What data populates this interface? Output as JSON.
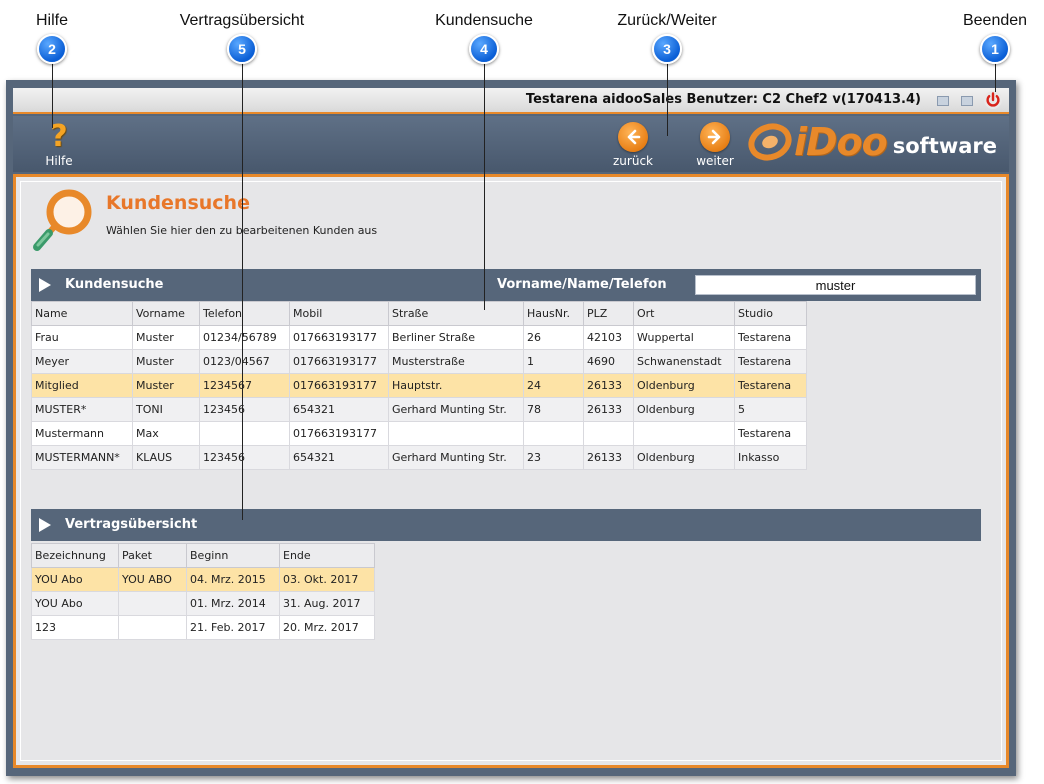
{
  "callouts": [
    {
      "label": "Hilfe",
      "number": "2"
    },
    {
      "label": "Vertragsübersicht",
      "number": "5"
    },
    {
      "label": "Kundensuche",
      "number": "4"
    },
    {
      "label": "Zurück/Weiter",
      "number": "3"
    },
    {
      "label": "Beenden",
      "number": "1"
    }
  ],
  "window": {
    "title": "Testarena aidooSales Benutzer: C2 Chef2 v(170413.4)"
  },
  "toolbar": {
    "help_label": "Hilfe",
    "back_label": "zurück",
    "forward_label": "weiter",
    "brand_main": "iDoo",
    "brand_sub": "software"
  },
  "colors": {
    "accent": "#e8892a",
    "header": "#56667a",
    "selected_row": "#fde3a6",
    "badge": "#0b5fd6"
  },
  "page": {
    "title": "Kundensuche",
    "subtitle": "Wählen Sie hier den zu bearbeitenen Kunden aus"
  },
  "customer_search": {
    "section_title": "Kundensuche",
    "search_label": "Vorname/Name/Telefon",
    "search_value": "muster",
    "columns": [
      "Name",
      "Vorname",
      "Telefon",
      "Mobil",
      "Straße",
      "HausNr.",
      "PLZ",
      "Ort",
      "Studio"
    ],
    "rows": [
      [
        "Frau",
        "Muster",
        "01234/56789",
        "017663193177",
        "Berliner Straße",
        "26",
        "42103",
        "Wuppertal",
        "Testarena"
      ],
      [
        "Meyer",
        "Muster",
        "0123/04567",
        "017663193177",
        "Musterstraße",
        "1",
        "4690",
        "Schwanenstadt",
        "Testarena"
      ],
      [
        "Mitglied",
        "Muster",
        "1234567",
        "017663193177",
        "Hauptstr.",
        "24",
        "26133",
        "Oldenburg",
        "Testarena"
      ],
      [
        "MUSTER*",
        "TONI",
        "123456",
        "654321",
        "Gerhard Munting Str.",
        "78",
        "26133",
        "Oldenburg",
        "5"
      ],
      [
        "Mustermann",
        "Max",
        "",
        "017663193177",
        "",
        "",
        "",
        "",
        "Testarena"
      ],
      [
        "MUSTERMANN*",
        "KLAUS",
        "123456",
        "654321",
        "Gerhard Munting Str.",
        "23",
        "26133",
        "Oldenburg",
        "Inkasso"
      ]
    ],
    "selected_index": 2
  },
  "contracts": {
    "section_title": "Vertragsübersicht",
    "columns": [
      "Bezeichnung",
      "Paket",
      "Beginn",
      "Ende"
    ],
    "rows": [
      [
        "YOU Abo",
        "YOU ABO",
        "04. Mrz. 2015",
        "03. Okt. 2017"
      ],
      [
        "YOU Abo",
        "",
        "01. Mrz. 2014",
        "31. Aug. 2017"
      ],
      [
        "123",
        "",
        "21. Feb. 2017",
        "20. Mrz. 2017"
      ]
    ],
    "selected_index": 0
  }
}
